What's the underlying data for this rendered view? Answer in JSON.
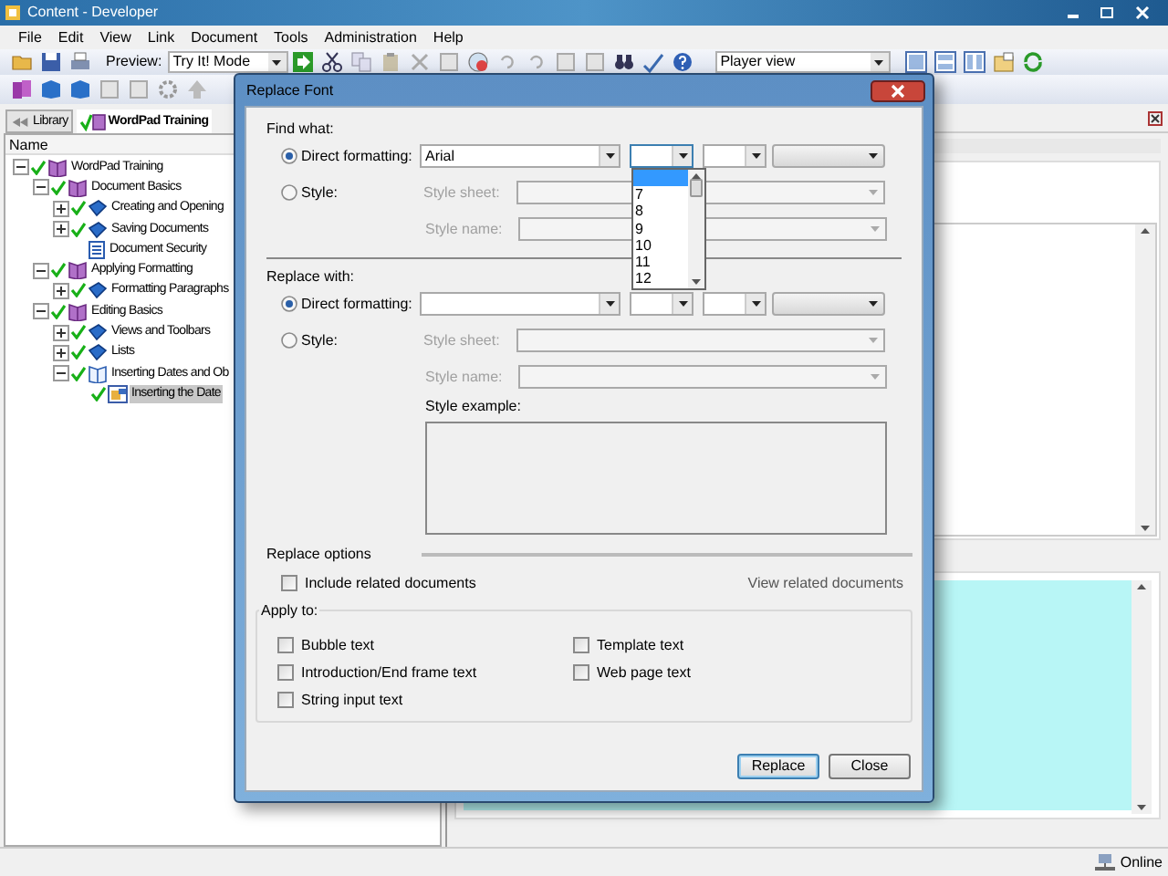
{
  "window": {
    "title": "Content - Developer"
  },
  "menu": [
    "File",
    "Edit",
    "View",
    "Link",
    "Document",
    "Tools",
    "Administration",
    "Help"
  ],
  "toolbar": {
    "preview_label": "Preview:",
    "preview_mode": "Try It! Mode",
    "view_mode": "Player view"
  },
  "tabs": [
    {
      "label": "Library",
      "selected": false
    },
    {
      "label": "WordPad Training",
      "selected": true
    }
  ],
  "tree": {
    "column": "Name",
    "items": [
      {
        "label": "WordPad Training",
        "kind": "module",
        "checked": true,
        "selected": false,
        "expanded": true,
        "children": [
          {
            "label": "Document Basics",
            "kind": "module",
            "checked": true,
            "selected": false,
            "expanded": true,
            "children": [
              {
                "label": "Creating and Opening",
                "kind": "section",
                "checked": true,
                "selected": false,
                "expanded": false
              },
              {
                "label": "Saving Documents",
                "kind": "section",
                "checked": true,
                "selected": false,
                "expanded": false
              },
              {
                "label": "Document Security",
                "kind": "document",
                "checked": false,
                "selected": false
              }
            ]
          },
          {
            "label": "Applying Formatting",
            "kind": "module",
            "checked": true,
            "selected": false,
            "expanded": true,
            "children": [
              {
                "label": "Formatting Paragraphs",
                "kind": "section",
                "checked": true,
                "selected": false,
                "expanded": false
              }
            ]
          },
          {
            "label": "Editing Basics",
            "kind": "module",
            "checked": true,
            "selected": false,
            "expanded": true,
            "children": [
              {
                "label": "Views and Toolbars",
                "kind": "section",
                "checked": true,
                "selected": false,
                "expanded": false
              },
              {
                "label": "Lists",
                "kind": "section",
                "checked": true,
                "selected": false,
                "expanded": false
              },
              {
                "label": "Inserting Dates and Ob",
                "kind": "section",
                "checked": true,
                "selected": false,
                "expanded": true,
                "children": [
                  {
                    "label": "Inserting the Date",
                    "kind": "topic",
                    "checked": true,
                    "selected": true
                  }
                ]
              }
            ]
          }
        ]
      }
    ]
  },
  "dialog": {
    "title": "Replace Font",
    "find": {
      "heading": "Find what:",
      "options": [
        {
          "label": "Direct formatting:",
          "selected": true
        },
        {
          "label": "Style:",
          "selected": false
        }
      ],
      "font": "Arial",
      "style_sheet_label": "Style sheet:",
      "style_name_label": "Style name:"
    },
    "size_dropdown": {
      "blank_selected": true,
      "items": [
        {
          "label": "7",
          "selected": false
        },
        {
          "label": "8",
          "selected": false
        },
        {
          "label": "9",
          "selected": false
        },
        {
          "label": "10",
          "selected": false
        },
        {
          "label": "11",
          "selected": false
        },
        {
          "label": "12",
          "selected": false
        }
      ]
    },
    "replace": {
      "heading": "Replace with:",
      "options": [
        {
          "label": "Direct formatting:",
          "selected": true
        },
        {
          "label": "Style:",
          "selected": false
        }
      ],
      "style_sheet_label": "Style sheet:",
      "style_name_label": "Style name:",
      "style_example_label": "Style example:"
    },
    "options_heading": "Replace options",
    "include_related": {
      "label": "Include related documents",
      "checked": false
    },
    "view_related_link": "View related documents",
    "apply_to": {
      "heading": "Apply to:",
      "columns": [
        [
          {
            "label": "Bubble text",
            "checked": false
          },
          {
            "label": "Introduction/End frame text",
            "checked": false
          },
          {
            "label": "String input text",
            "checked": false
          }
        ],
        [
          {
            "label": "Template text",
            "checked": false
          },
          {
            "label": "Web page text",
            "checked": false
          }
        ]
      ]
    },
    "buttons": [
      {
        "label": "Replace",
        "default": true
      },
      {
        "label": "Close",
        "default": false
      }
    ]
  },
  "status_bar": {
    "text": "Online"
  }
}
